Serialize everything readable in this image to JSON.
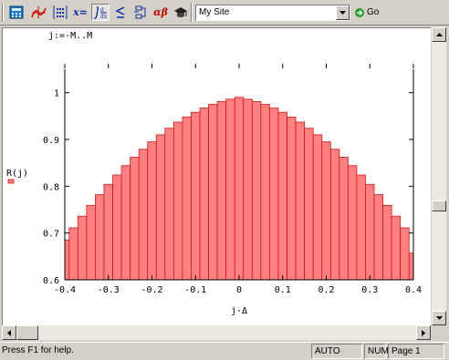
{
  "toolbar": {
    "insert_var_text": "x=",
    "greek_text": "αβ",
    "site_select_value": "My Site",
    "go_label": "Go"
  },
  "worksheet": {
    "definition": "j:=-M..M"
  },
  "chart_data": {
    "type": "bar",
    "xlabel": "j·Δ",
    "ylabel": "R(j)",
    "xlim": [
      -0.4,
      0.4
    ],
    "ylim": [
      0.6,
      1.05
    ],
    "xticks": [
      -0.4,
      -0.3,
      -0.2,
      -0.1,
      0,
      0.1,
      0.2,
      0.3,
      0.4
    ],
    "xtick_labels": [
      "-0.4",
      "-0.3",
      "-0.2",
      "-0.1",
      "0",
      "0.1",
      "0.2",
      "0.3",
      "0.4"
    ],
    "yticks": [
      0.6,
      0.7,
      0.8,
      0.9,
      1.0
    ],
    "ytick_labels": [
      "0.6",
      "0.7",
      "0.8",
      "0.9",
      "1"
    ],
    "bar_width": 0.02,
    "x": [
      -0.4,
      -0.38,
      -0.36,
      -0.34,
      -0.32,
      -0.3,
      -0.28,
      -0.26,
      -0.24,
      -0.22,
      -0.2,
      -0.18,
      -0.16,
      -0.14,
      -0.12,
      -0.1,
      -0.08,
      -0.06,
      -0.04,
      -0.02,
      0,
      0.02,
      0.04,
      0.06,
      0.08,
      0.1,
      0.12,
      0.14,
      0.16,
      0.18,
      0.2,
      0.22,
      0.24,
      0.26,
      0.28,
      0.3,
      0.32,
      0.34,
      0.36,
      0.38,
      0.4
    ],
    "values": [
      0.685,
      0.711,
      0.736,
      0.759,
      0.782,
      0.804,
      0.824,
      0.844,
      0.862,
      0.879,
      0.895,
      0.91,
      0.924,
      0.937,
      0.948,
      0.958,
      0.967,
      0.975,
      0.981,
      0.986,
      0.99,
      0.986,
      0.981,
      0.975,
      0.967,
      0.958,
      0.948,
      0.937,
      0.924,
      0.91,
      0.895,
      0.879,
      0.862,
      0.844,
      0.824,
      0.804,
      0.782,
      0.759,
      0.736,
      0.711,
      0.657
    ],
    "bar_fill": "#ff8080",
    "bar_stroke": "#d01818",
    "grid": false
  },
  "status": {
    "message": "Press F1 for help.",
    "auto": "AUTO",
    "num": "NUM",
    "page": "Page 1"
  }
}
